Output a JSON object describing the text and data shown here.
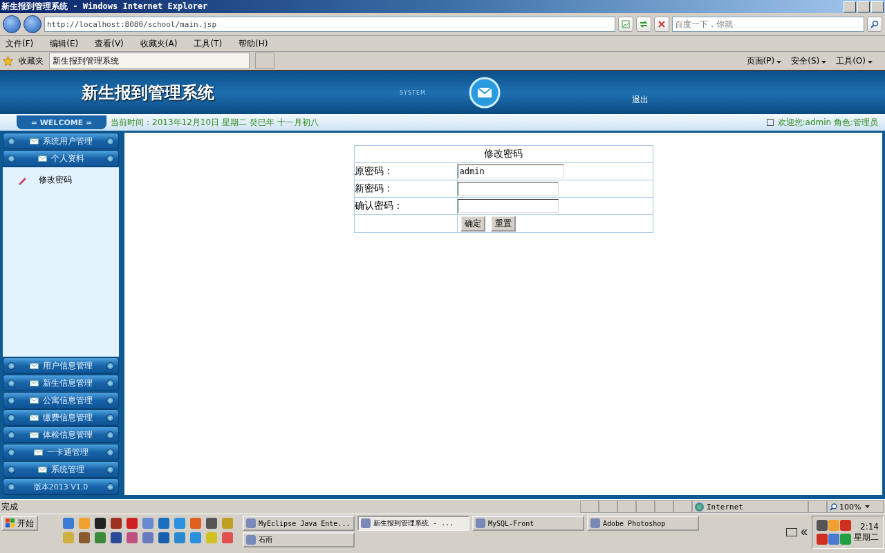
{
  "window": {
    "title": "新生报到管理系统 - Windows Internet Explorer"
  },
  "address_bar": {
    "url": "http://localhost:8080/school/main.jsp"
  },
  "search": {
    "placeholder": "百度一下，你就"
  },
  "menu": [
    "文件(F)",
    "编辑(E)",
    "查看(V)",
    "收藏夹(A)",
    "工具(T)",
    "帮助(H)"
  ],
  "favorites": {
    "label": "收藏夹"
  },
  "tabs": [
    {
      "label": "新生报到管理系统",
      "selected": true
    }
  ],
  "command_bar": [
    "页面(P)",
    "安全(S)",
    "工具(O)"
  ],
  "page": {
    "header": {
      "title": "新生报到管理系统",
      "badge": "SYSTEM",
      "logout": "退出"
    },
    "welcome_bar": {
      "welcome": "= WELCOME =",
      "time": "当前时间：2013年12月10日 星期二 癸巳年 十一月初八",
      "user": "欢迎您:admin 角色:管理员"
    },
    "sidebar": {
      "sections": [
        {
          "label": "系统用户管理"
        },
        {
          "label": "个人资料",
          "children": [
            {
              "label": "修改密码"
            }
          ]
        },
        {
          "label": "用户信息管理"
        },
        {
          "label": "新生信息管理"
        },
        {
          "label": "公寓信息管理"
        },
        {
          "label": "缴费信息管理"
        },
        {
          "label": "体检信息管理"
        },
        {
          "label": "一卡通管理"
        },
        {
          "label": "系统管理"
        }
      ],
      "version": "版本2013 V1.0"
    },
    "form": {
      "title": "修改密码",
      "fields": [
        {
          "label": "原密码：",
          "value": "admin"
        },
        {
          "label": "新密码："
        },
        {
          "label": "确认密码："
        }
      ],
      "buttons": [
        "确定",
        "重置"
      ]
    }
  },
  "status_bar": {
    "text": "完成",
    "zone": "Internet",
    "zoom": "100%"
  },
  "taskbar": {
    "start": "开始",
    "tasks": [
      {
        "label": "MyEclipse Java Ente...",
        "selected": false
      },
      {
        "label": "新生报到管理系统 - ...",
        "selected": true
      },
      {
        "label": "MySQL-Front",
        "selected": false
      },
      {
        "label": "Adobe Photoshop",
        "selected": false
      },
      {
        "label": "石雨",
        "selected": false
      }
    ],
    "clock": "2:14",
    "day": "星期二"
  }
}
